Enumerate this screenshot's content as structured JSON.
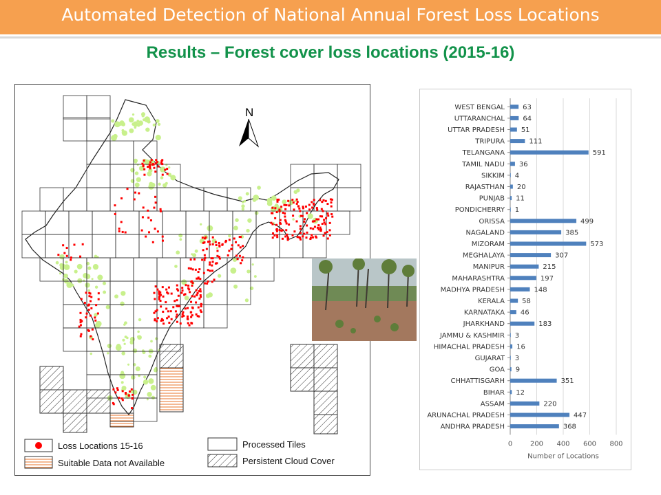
{
  "header": {
    "title": "Automated Detection of National Annual Forest Loss Locations"
  },
  "subtitle": "Results – Forest cover loss locations (2015-16)",
  "map": {
    "north_label": "N",
    "legend": {
      "loss_locations": "Loss Locations 15-16",
      "processed_tiles": "Processed Tiles",
      "suitable_data": "Suitable Data not Available",
      "cloud_cover": "Persistent Cloud Cover"
    },
    "colors": {
      "loss": "#ff0000",
      "forest": "#c8f08c",
      "tile_line": "#333333"
    }
  },
  "chart_data": {
    "type": "bar",
    "orientation": "horizontal",
    "categories": [
      "WEST BENGAL",
      "UTTARANCHAL",
      "UTTAR PRADESH",
      "TRIPURA",
      "TELANGANA",
      "TAMIL NADU",
      "SIKKIM",
      "RAJASTHAN",
      "PUNJAB",
      "PONDICHERRY",
      "ORISSA",
      "NAGALAND",
      "MIZORAM",
      "MEGHALAYA",
      "MANIPUR",
      "MAHARASHTRA",
      "MADHYA PRADESH",
      "KERALA",
      "KARNATAKA",
      "JHARKHAND",
      "JAMMU & KASHMIR",
      "HIMACHAL PRADESH",
      "GUJARAT",
      "GOA",
      "CHHATTISGARH",
      "BIHAR",
      "ASSAM",
      "ARUNACHAL PRADESH",
      "ANDHRA PRADESH"
    ],
    "values": [
      63,
      64,
      51,
      111,
      591,
      36,
      4,
      20,
      11,
      1,
      499,
      385,
      573,
      307,
      215,
      197,
      148,
      58,
      46,
      183,
      3,
      16,
      3,
      9,
      351,
      12,
      220,
      447,
      368
    ],
    "xlabel": "Number of Locations",
    "ylabel": "",
    "xlim": [
      0,
      800
    ],
    "xticks": [
      0,
      200,
      400,
      600,
      800
    ],
    "grid": true,
    "bar_color": "#4f81bd"
  }
}
